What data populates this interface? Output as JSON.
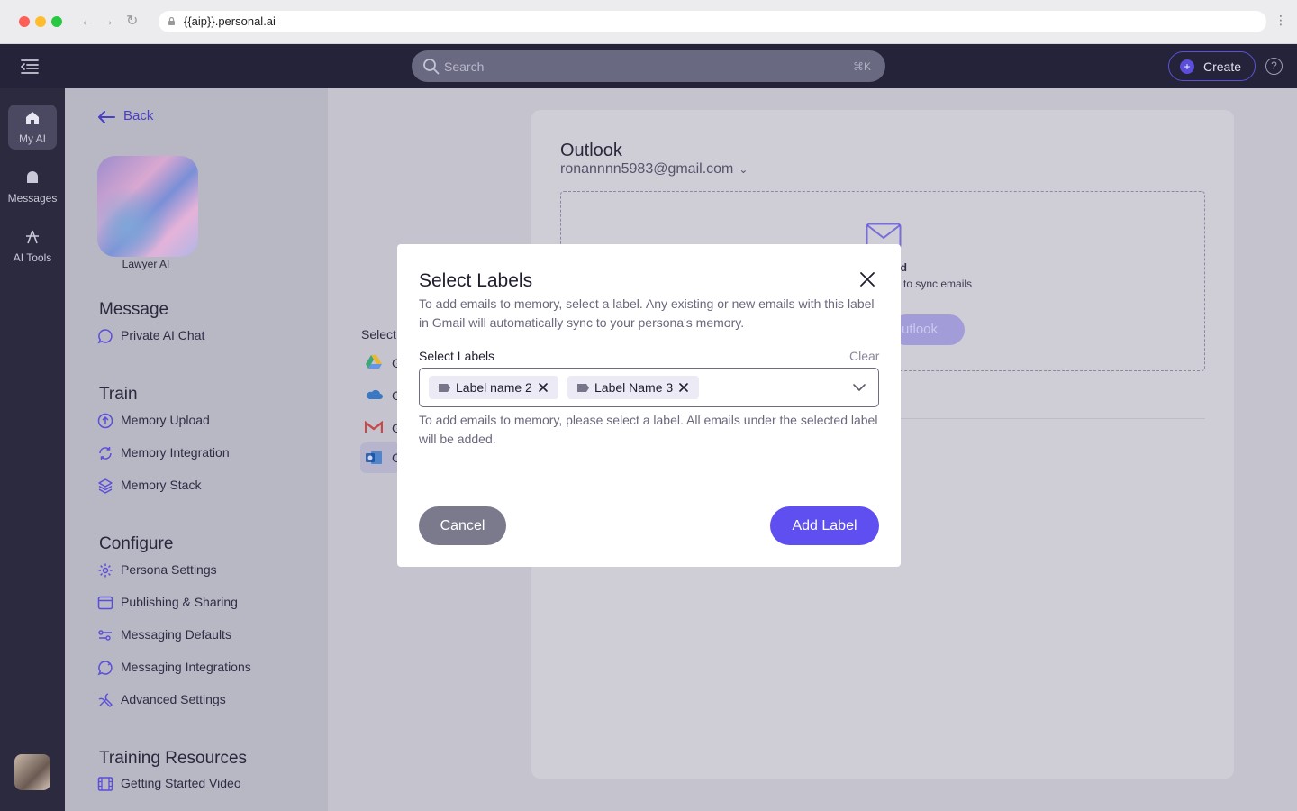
{
  "browser": {
    "url": "{{aip}}.personal.ai",
    "back_icon": "arrow-left",
    "forward_icon": "arrow-right",
    "reload_icon": "reload"
  },
  "header": {
    "search_placeholder": "Search",
    "search_shortcut": "⌘K",
    "create_label": "Create",
    "help_icon": "?"
  },
  "rail": {
    "items": [
      {
        "label": "My AI",
        "icon": "home-icon",
        "active": true
      },
      {
        "label": "Messages",
        "icon": "messages-icon",
        "active": false
      },
      {
        "label": "AI Tools",
        "icon": "ai-tools-icon",
        "active": false
      }
    ]
  },
  "sidebar": {
    "back_label": "Back",
    "persona_name": "Lawyer AI",
    "sections": {
      "message": {
        "title": "Message",
        "items": [
          "Private AI Chat"
        ]
      },
      "train": {
        "title": "Train",
        "items": [
          "Memory Upload",
          "Memory Integration",
          "Memory Stack"
        ]
      },
      "configure": {
        "title": "Configure",
        "items": [
          "Persona Settings",
          "Publishing & Sharing",
          "Messaging Defaults",
          "Messaging Integrations",
          "Advanced Settings"
        ]
      },
      "resources": {
        "title": "Training Resources",
        "items": [
          "Getting Started Video"
        ]
      }
    }
  },
  "main": {
    "select_label": "Select",
    "sources": [
      {
        "letter": "G",
        "icon": "google-drive-icon"
      },
      {
        "letter": "O",
        "icon": "onedrive-icon"
      },
      {
        "letter": "G",
        "icon": "gmail-icon"
      },
      {
        "letter": "O",
        "icon": "outlook-icon"
      }
    ],
    "card": {
      "title": "Outlook",
      "email": "ronannnn5983@gmail.com",
      "status_partial": "ted",
      "sub_partial": "to sync emails",
      "button_partial": "utlook"
    }
  },
  "modal": {
    "title": "Select Labels",
    "description": "To add emails to memory, select a label. Any existing or new emails with this label in Gmail will automatically sync to your persona's memory.",
    "field_label": "Select Labels",
    "clear_label": "Clear",
    "chips": [
      "Label name 2",
      "Label Name 3"
    ],
    "helper": "To add emails to memory, please select a label. All emails under the selected label will be added.",
    "cancel_label": "Cancel",
    "add_label": "Add Label"
  },
  "colors": {
    "accent": "#5f4ff1",
    "rail_bg": "#2b2a3f",
    "header_bg": "#24233a"
  }
}
